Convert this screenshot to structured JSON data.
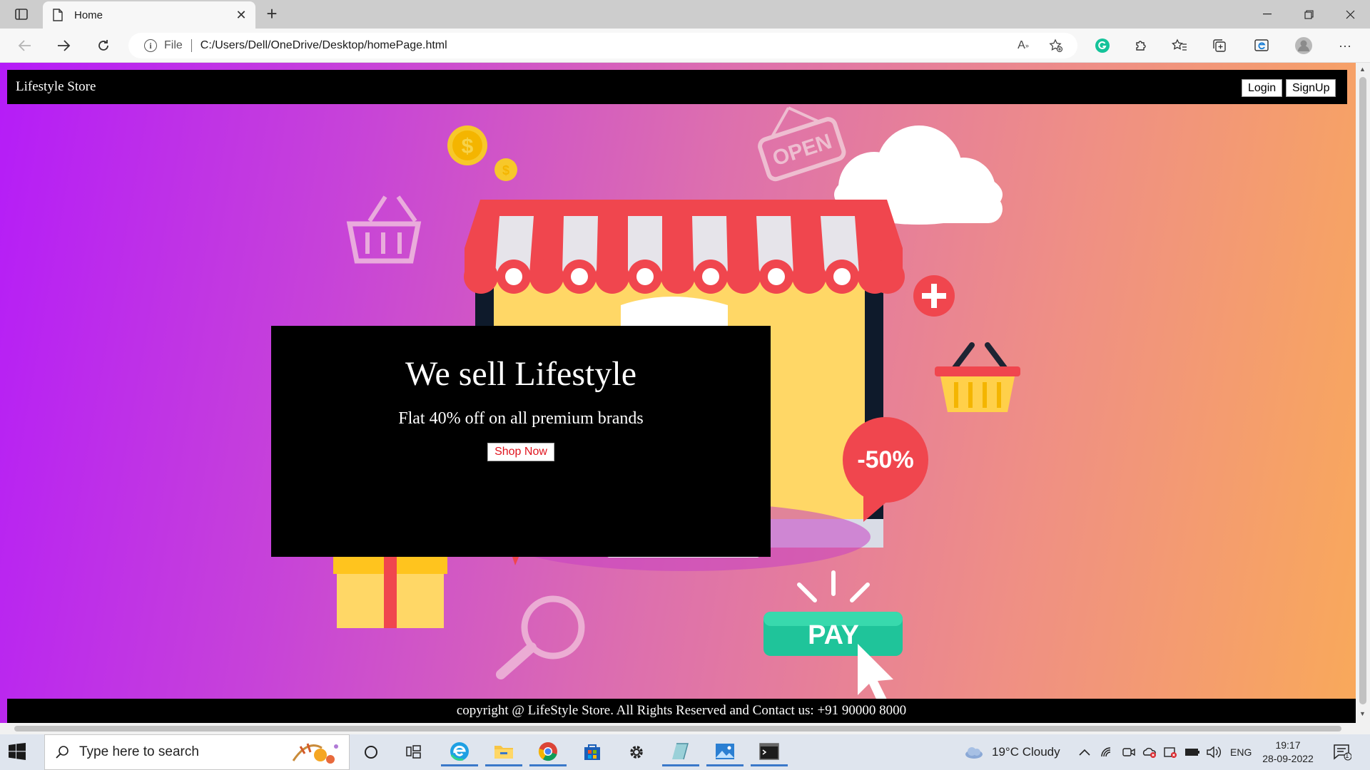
{
  "browser": {
    "tab_title": "Home",
    "url_scheme_label": "File",
    "url": "C:/Users/Dell/OneDrive/Desktop/homePage.html"
  },
  "site": {
    "brand": "Lifestyle Store",
    "nav": {
      "login": "Login",
      "signup": "SignUp"
    },
    "hero": {
      "title": "We sell Lifestyle",
      "subtitle": "Flat 40% off on all premium brands",
      "cta": "Shop Now"
    },
    "illustration": {
      "open_sign": "OPEN",
      "discount": "-50%",
      "pay_button": "PAY",
      "coin_symbol": "$"
    },
    "footer": "copyright @ LifeStyle Store. All Rights Reserved and Contact us: +91 90000 8000"
  },
  "taskbar": {
    "search_placeholder": "Type here to search",
    "weather": "19°C  Cloudy",
    "language": "ENG",
    "time": "19:17",
    "date": "28-09-2022",
    "notification_count": "1"
  },
  "colors": {
    "gradient_start": "#b51cf8",
    "gradient_end": "#f9a95a",
    "awning_red": "#f0464e",
    "screen_yellow": "#ffd766",
    "pay_green": "#1fc49a",
    "shop_now_text": "#e0141e"
  }
}
